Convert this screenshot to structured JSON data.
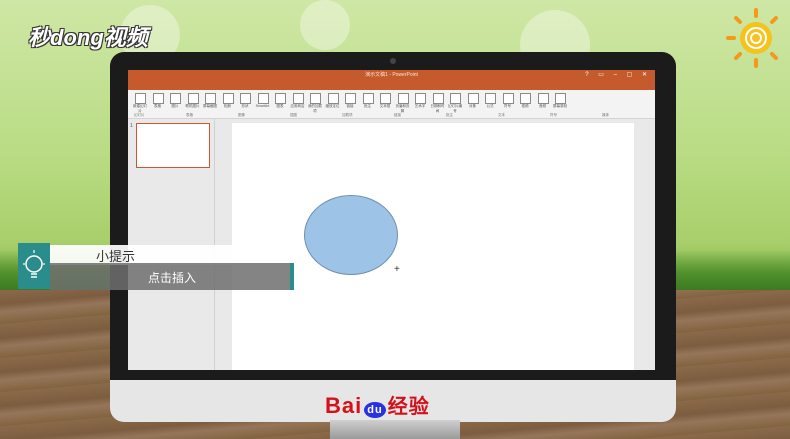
{
  "watermark": {
    "logo_text": "秒dong视频"
  },
  "brand": {
    "baidu": "Bai",
    "du": "du",
    "jingyan": "经验"
  },
  "app": {
    "title": "演示文稿1 - PowerPoint",
    "window_controls": "? ▭ – ▢ ✕",
    "tabs": [
      "文件",
      "开始",
      "插入",
      "设计",
      "切换",
      "动画",
      "幻灯片放映",
      "审阅",
      "视图",
      "♀ 告诉我您想要做什么..."
    ],
    "active_tab_index": 2,
    "ribbon_buttons": [
      "新建幻灯片",
      "表格",
      "图片",
      "联机图片",
      "屏幕截图",
      "相册",
      "形状",
      "SmartArt",
      "图表",
      "应用商店",
      "我的加载项",
      "缩放定位",
      "链接",
      "批注",
      "文本框",
      "页眉和页脚",
      "艺术字",
      "日期和时间",
      "幻灯片编号",
      "对象",
      "公式",
      "符号",
      "视频",
      "音频",
      "屏幕录制"
    ],
    "ribbon_groups": [
      "幻灯片",
      "表格",
      "图像",
      "插图",
      "加载项",
      "链接",
      "批注",
      "文本",
      "符号",
      "媒体"
    ],
    "slide_number": "1"
  },
  "tip": {
    "title": "小提示",
    "text": "点击插入"
  },
  "colors": {
    "accent": "#2a8d8b",
    "ppt_orange": "#c55a2d",
    "shape_fill": "#9dc3e6",
    "baidu_red": "#d4101b"
  }
}
